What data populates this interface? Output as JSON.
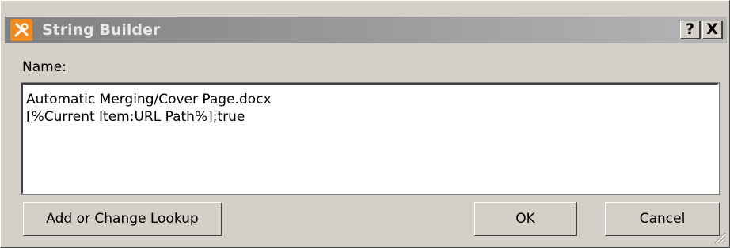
{
  "window": {
    "title": "String Builder",
    "help_label": "?",
    "close_label": "X"
  },
  "form": {
    "name_label": "Name:",
    "value_line1": "Automatic Merging/Cover Page.docx",
    "value_lookup": "[%Current Item:URL Path%]",
    "value_suffix": ";true"
  },
  "buttons": {
    "lookup_label": "Add or Change Lookup",
    "ok_label": "OK",
    "cancel_label": "Cancel"
  },
  "icons": {
    "title_icon": "tools-icon",
    "grip": "resize-grip-icon"
  },
  "colors": {
    "icon_orange": "#f28a1e",
    "dialog_face": "#d4d0c8"
  }
}
